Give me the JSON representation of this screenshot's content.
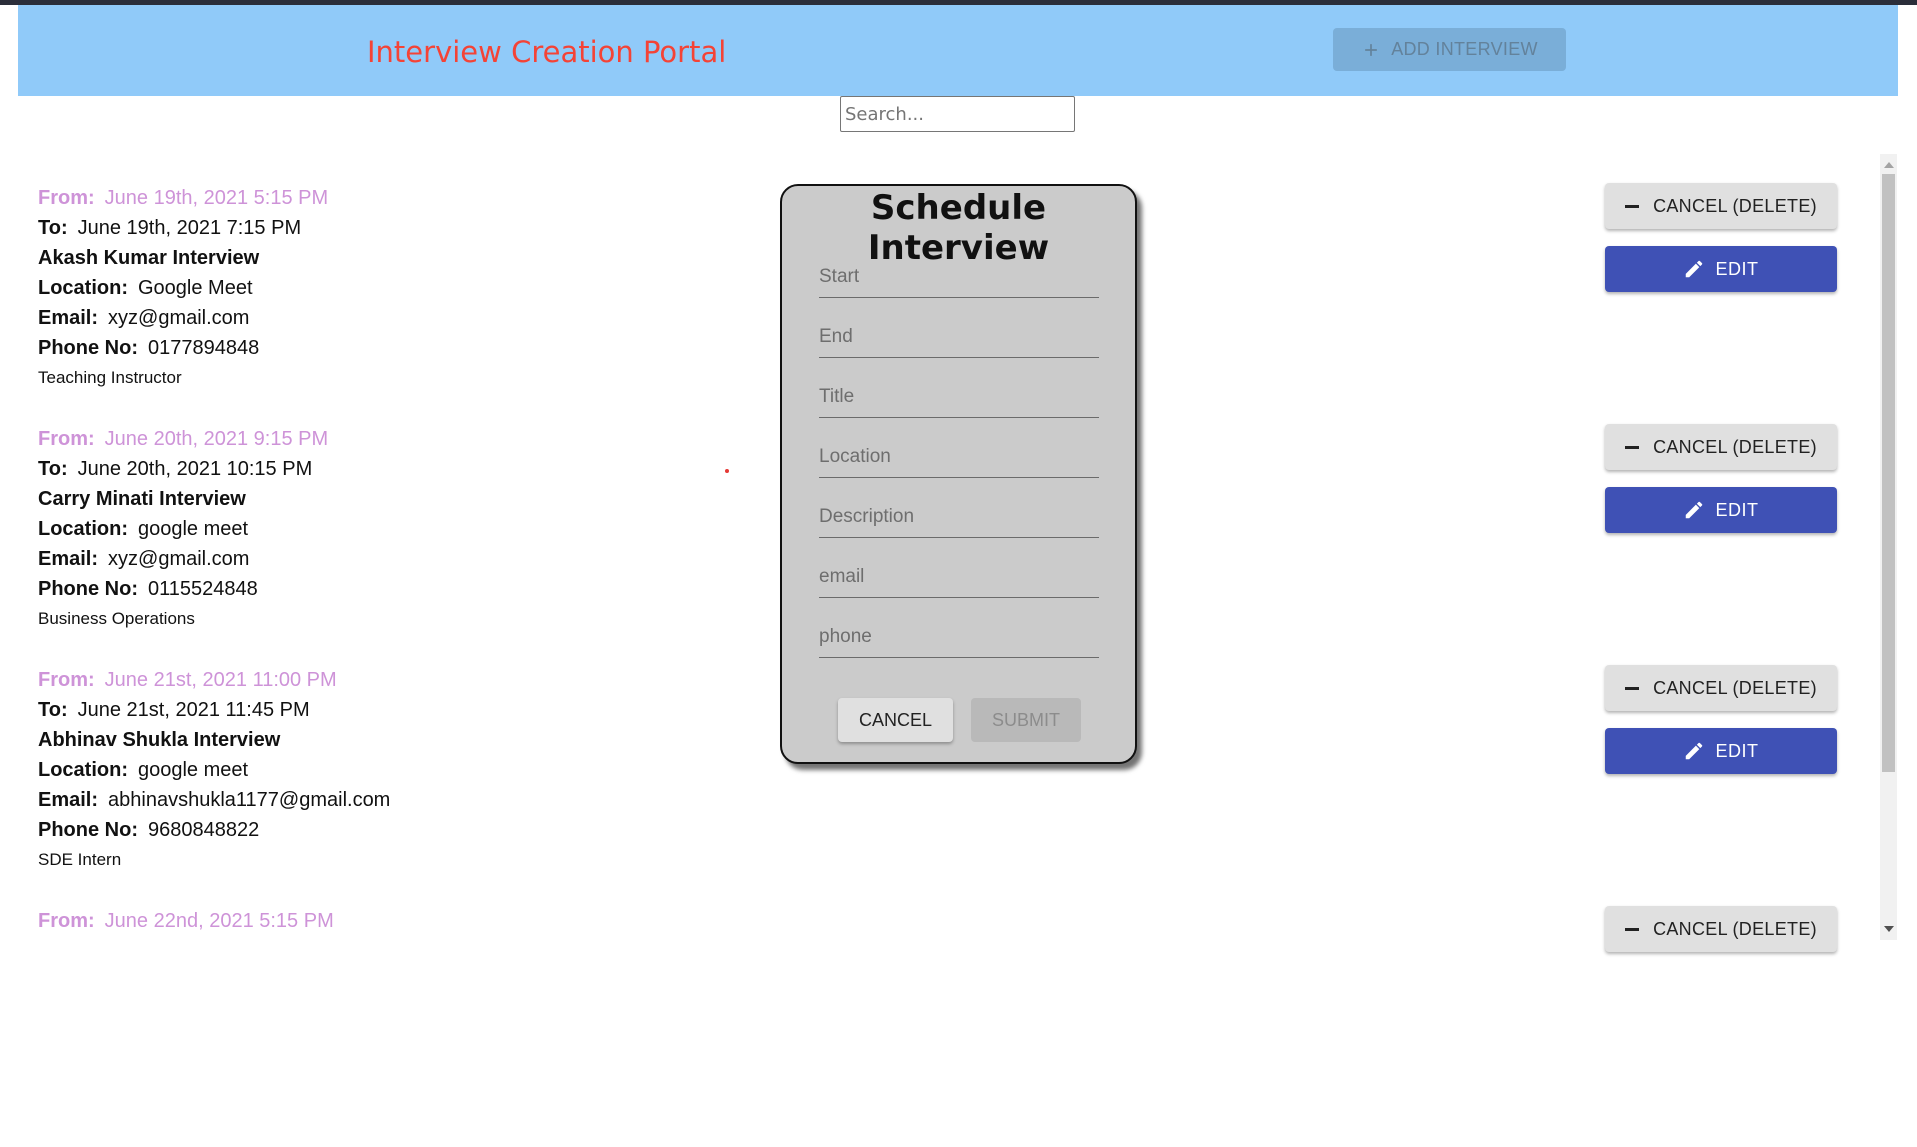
{
  "header": {
    "title": "Interview Creation Portal",
    "add_button": "ADD INTERVIEW"
  },
  "search": {
    "placeholder": "Search..."
  },
  "labels": {
    "from": "From:",
    "to": "To:",
    "location": "Location:",
    "email": "Email:",
    "phone": "Phone No:"
  },
  "interviews": [
    {
      "from": "June 19th, 2021 5:15 PM",
      "to": "June 19th, 2021 7:15 PM",
      "title": "Akash Kumar Interview",
      "location": "Google Meet",
      "email": "xyz@gmail.com",
      "phone": "0177894848",
      "description": "Teaching Instructor"
    },
    {
      "from": "June 20th, 2021 9:15 PM",
      "to": "June 20th, 2021 10:15 PM",
      "title": "Carry Minati Interview",
      "location": "google meet",
      "email": "xyz@gmail.com",
      "phone": "0115524848",
      "description": "Business Operations"
    },
    {
      "from": "June 21st, 2021 11:00 PM",
      "to": "June 21st, 2021 11:45 PM",
      "title": "Abhinav Shukla Interview",
      "location": "google meet",
      "email": "abhinavshukla1177@gmail.com",
      "phone": "9680848822",
      "description": "SDE Intern"
    },
    {
      "from": "June 22nd, 2021 5:15 PM"
    }
  ],
  "actions": {
    "cancel_delete": "CANCEL (DELETE)",
    "edit": "EDIT"
  },
  "modal": {
    "title": "Schedule Interview",
    "fields": [
      "Start",
      "End",
      "Title",
      "Location",
      "Description",
      "email",
      "phone"
    ],
    "cancel": "CANCEL",
    "submit": "SUBMIT"
  },
  "colors": {
    "header_bg": "#90caf9",
    "title_red": "#f44336",
    "from_purple": "#ce93d8",
    "edit_blue": "#3f51b5",
    "modal_bg": "#cbcbcb"
  }
}
